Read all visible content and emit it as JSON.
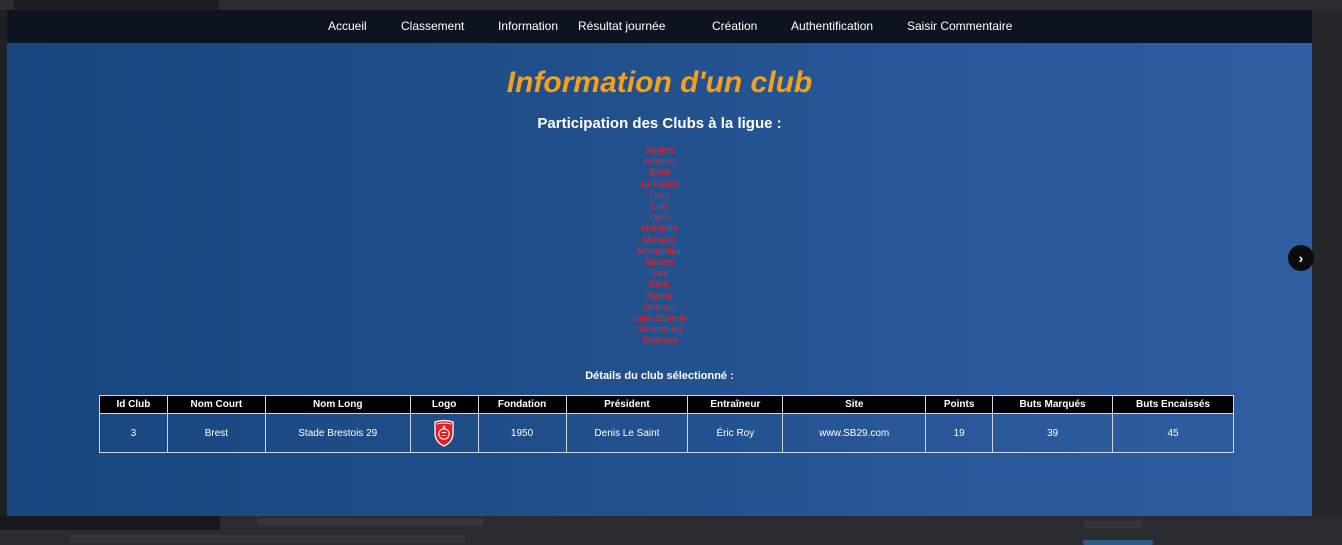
{
  "nav": {
    "items": [
      "Accueil",
      "Classement",
      "Information",
      "Résultat journée",
      "Création",
      "Authentification",
      "Saisir Commentaire"
    ]
  },
  "title": "Information d'un club",
  "subtitle": "Participation des Clubs à la ligue :",
  "clubs": [
    "Angers",
    "Auxerre",
    "Brest",
    "Le Havre",
    "Lens",
    "Lille",
    "Lyon",
    "Marseille",
    "Monaco",
    "Montpellier",
    "Nantes",
    "Nice",
    "Paris",
    "Reims",
    "Rennes",
    "Saint-Etienne",
    "Strasbourg",
    "Toulouse"
  ],
  "details_title": "Détails du club sélectionné :",
  "table": {
    "headers": [
      "Id Club",
      "Nom Court",
      "Nom Long",
      "Logo",
      "Fondation",
      "Président",
      "Entraîneur",
      "Site",
      "Points",
      "Buts Marqués",
      "Buts Encaissés"
    ],
    "row": {
      "id": "3",
      "nom_court": "Brest",
      "nom_long": "Stade Brestois 29",
      "logo_icon": "brest-crest-icon",
      "fondation": "1950",
      "president": "Denis Le Saint",
      "entraineur": "Éric Roy",
      "site": "www.SB29.com",
      "points": "19",
      "buts_marques": "39",
      "buts_encaisses": "45"
    }
  },
  "next_icon": "chevron-right-icon",
  "colors": {
    "navbar": "#0d1321",
    "panel": "#1f4e89",
    "title": "#f5a01a",
    "club_link": "#e8232b",
    "table_header": "#000000"
  }
}
